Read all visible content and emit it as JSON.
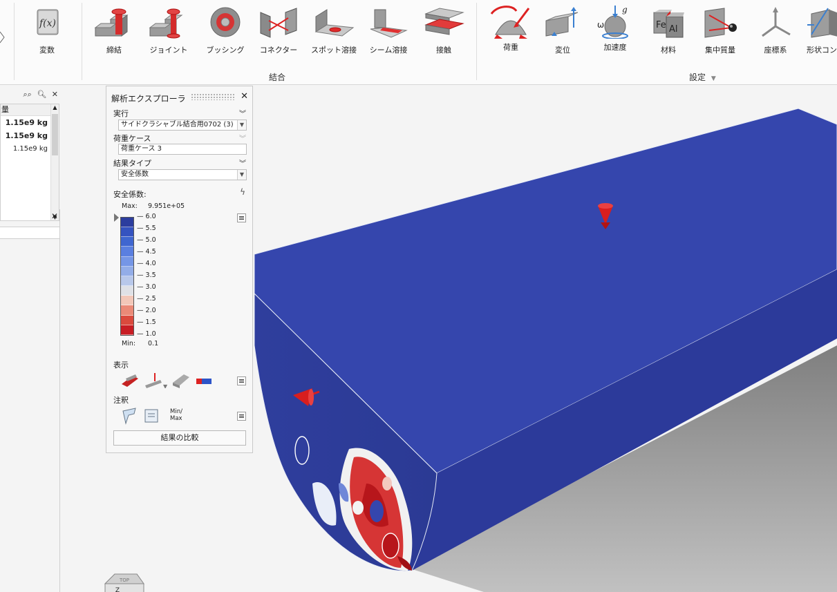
{
  "ribbon": {
    "variables": "変数",
    "connections_group": "結合",
    "fastener": "締結",
    "joint": "ジョイント",
    "bushing": "ブッシング",
    "connector": "コネクター",
    "spot_weld": "スポット溶接",
    "seam_weld": "シーム溶接",
    "contact": "接触",
    "load": "荷重",
    "displacement": "変位",
    "acceleration": "加速度",
    "material": "材料",
    "concentrated_mass": "集中質量",
    "coordinate_system": "座標系",
    "shape_control": "形状コン",
    "settings_group": "設定",
    "accel_omega": "ω",
    "accel_g": "g",
    "material_fe": "Fe",
    "material_al": "Al"
  },
  "left_panel": {
    "header": "量",
    "rows": [
      "1.15e9 kg",
      "1.15e9 kg",
      "1.15e9 kg"
    ]
  },
  "explorer": {
    "title": "解析エクスプローラ",
    "run_label": "実行",
    "run_value": "サイドクラシャブル結合用0702 (3)",
    "loadcase_label": "荷重ケース",
    "loadcase_value": "荷重ケース 3",
    "result_type_label": "結果タイプ",
    "result_type_value": "安全係数",
    "legend_title": "安全係数:",
    "max_label": "Max:",
    "max_value": "9.951e+05",
    "min_label": "Min:",
    "min_value": "0.1",
    "ticks": [
      "— 6.0",
      "— 5.5",
      "— 5.0",
      "— 4.5",
      "— 4.0",
      "— 3.5",
      "— 3.0",
      "— 2.5",
      "— 2.0",
      "— 1.5",
      "— 1.0"
    ],
    "legend_colors": [
      "#2c3d9e",
      "#3553c0",
      "#3f66d0",
      "#5a7fe0",
      "#7596e6",
      "#93ade8",
      "#b8c8ea",
      "#dfe1e6",
      "#f2c7b8",
      "#ea8a77",
      "#da4a3d",
      "#c81d24"
    ],
    "display_label": "表示",
    "annotation_label": "注釈",
    "minmax_line1": "Min/",
    "minmax_line2": "Max",
    "compare_button": "結果の比較"
  },
  "viewcube": {
    "top": "TOP",
    "axis": "Z"
  },
  "colors": {
    "model_top": "#3546ad",
    "model_side": "#2f3e9c",
    "critical": "#c8171e",
    "load_marker": "#d81e1e"
  }
}
